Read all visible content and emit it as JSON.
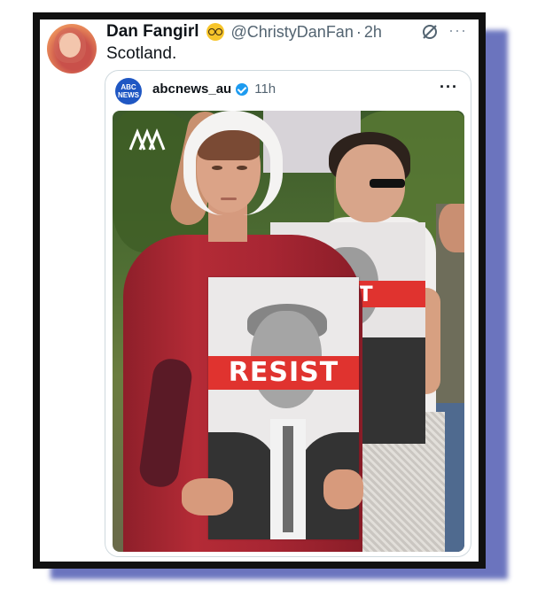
{
  "tweet": {
    "display_name": "Dan Fangirl",
    "emoji": "nerd-face-emoji",
    "handle": "@ChristyDanFan",
    "separator": "·",
    "time": "2h",
    "text": "Scotland.",
    "more": "···"
  },
  "quoted_tweet": {
    "avatar_text": "ABC NEWS",
    "account": "abcnews_au",
    "verified": true,
    "time": "11h",
    "more": "···",
    "image": {
      "sign_text_main": "RESIST",
      "sign_text_back": "ST",
      "watermark": "ABC logo"
    }
  },
  "colors": {
    "frame": "#111111",
    "frame_shadow": "#5b66b8",
    "verified_blue": "#1d9bf0",
    "resist_red": "#e0332f"
  }
}
